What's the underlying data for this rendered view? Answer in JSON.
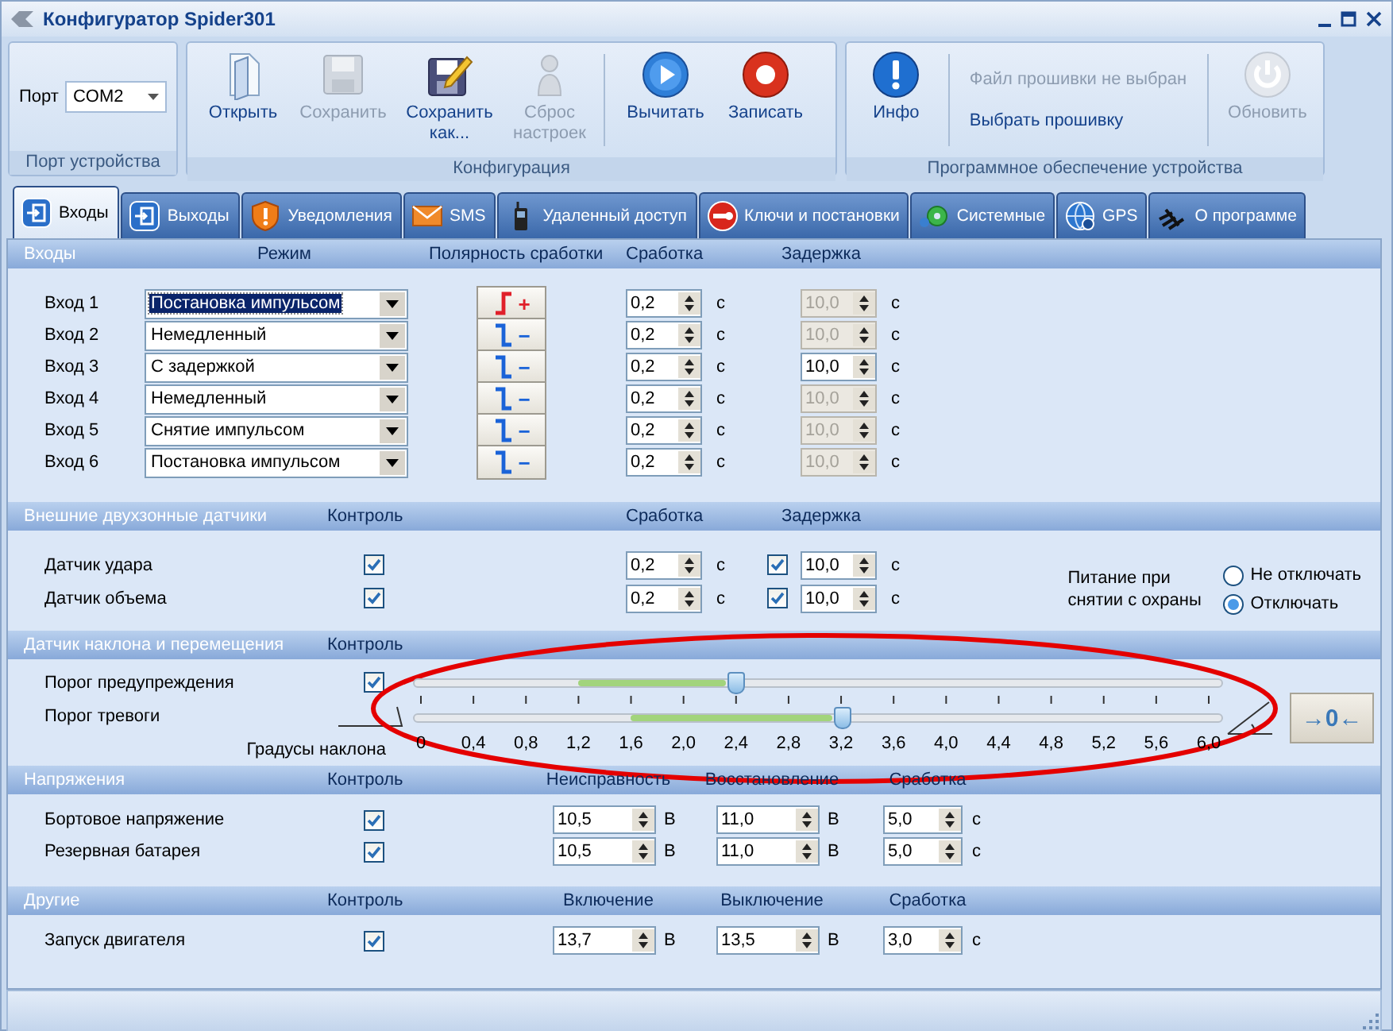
{
  "window": {
    "title": "Конфигуратор Spider301"
  },
  "ribbon": {
    "port_group": {
      "label": "Порт",
      "value": "COM2",
      "caption": "Порт устройства"
    },
    "config_group": {
      "caption": "Конфигурация",
      "file_buttons": [
        {
          "kind": "open",
          "label": "Открыть",
          "disabled": false
        },
        {
          "kind": "save",
          "label": "Сохранить",
          "disabled": true
        },
        {
          "kind": "save_as",
          "label": "Сохранить как...",
          "disabled": false
        },
        {
          "kind": "reset",
          "label": "Сброс настроек",
          "disabled": true
        }
      ],
      "device_buttons": [
        {
          "kind": "read",
          "label": "Вычитать",
          "disabled": false
        },
        {
          "kind": "write",
          "label": "Записать",
          "disabled": false
        }
      ]
    },
    "software_group": {
      "caption": "Программное обеспечение устройства",
      "info_button": {
        "label": "Инфо",
        "disabled": false
      },
      "firmware_status": "Файл прошивки не выбран",
      "select_firmware": "Выбрать прошивку",
      "update_button": {
        "label": "Обновить",
        "disabled": true
      }
    }
  },
  "tabs": [
    {
      "kind": "inputs",
      "label": "Входы",
      "selected": true
    },
    {
      "kind": "outputs",
      "label": "Выходы",
      "selected": false
    },
    {
      "kind": "notifications",
      "label": "Уведомления",
      "selected": false
    },
    {
      "kind": "sms",
      "label": "SMS",
      "selected": false
    },
    {
      "kind": "remote",
      "label": "Удаленный доступ",
      "selected": false
    },
    {
      "kind": "keys",
      "label": "Ключи и постановки",
      "selected": false
    },
    {
      "kind": "system",
      "label": "Системные",
      "selected": false
    },
    {
      "kind": "gps",
      "label": "GPS",
      "selected": false
    },
    {
      "kind": "about",
      "label": "О программе",
      "selected": false
    }
  ],
  "inputs": {
    "title": "Входы",
    "columns": [
      "Режим",
      "Полярность сработки",
      "Сработка",
      "Задержка"
    ],
    "rows": [
      {
        "label": "Вход 1",
        "mode": "Постановка импульсом",
        "focused": true,
        "kind": "rising",
        "sign": "+",
        "trip": "0,2",
        "trip_unit": "с",
        "delay": "10,0",
        "delay_enabled": false,
        "delay_unit": "с"
      },
      {
        "label": "Вход 2",
        "mode": "Немедленный",
        "focused": false,
        "kind": "falling",
        "sign": "−",
        "trip": "0,2",
        "trip_unit": "с",
        "delay": "10,0",
        "delay_enabled": false,
        "delay_unit": "с"
      },
      {
        "label": "Вход 3",
        "mode": "С задержкой",
        "focused": false,
        "kind": "falling",
        "sign": "−",
        "trip": "0,2",
        "trip_unit": "с",
        "delay": "10,0",
        "delay_enabled": true,
        "delay_unit": "с"
      },
      {
        "label": "Вход 4",
        "mode": "Немедленный",
        "focused": false,
        "kind": "falling",
        "sign": "−",
        "trip": "0,2",
        "trip_unit": "с",
        "delay": "10,0",
        "delay_enabled": false,
        "delay_unit": "с"
      },
      {
        "label": "Вход 5",
        "mode": "Снятие импульсом",
        "focused": false,
        "kind": "falling",
        "sign": "−",
        "trip": "0,2",
        "trip_unit": "с",
        "delay": "10,0",
        "delay_enabled": false,
        "delay_unit": "с"
      },
      {
        "label": "Вход 6",
        "mode": "Постановка импульсом",
        "focused": false,
        "kind": "falling",
        "sign": "−",
        "trip": "0,2",
        "trip_unit": "с",
        "delay": "10,0",
        "delay_enabled": false,
        "delay_unit": "с"
      }
    ]
  },
  "sensors": {
    "title": "Внешние двухзонные датчики",
    "columns": [
      "Контроль",
      "Сработка",
      "Задержка"
    ],
    "rows": [
      {
        "label": "Датчик удара",
        "control": true,
        "trip": "0,2",
        "trip_unit": "с",
        "delay_checked": true,
        "delay": "10,0",
        "delay_unit": "с"
      },
      {
        "label": "Датчик объема",
        "control": true,
        "trip": "0,2",
        "trip_unit": "с",
        "delay_checked": true,
        "delay": "10,0",
        "delay_unit": "с"
      }
    ],
    "power": {
      "label": "Питание при снятии с охраны",
      "options": [
        {
          "label": "Не отключать",
          "selected": false
        },
        {
          "label": "Отключать",
          "selected": true
        }
      ]
    }
  },
  "tilt": {
    "title": "Датчик наклона и перемещения",
    "columns": [
      "Контроль"
    ],
    "rows": [
      {
        "kind": "checkbox",
        "label": "Порог предупреждения",
        "control": true,
        "level": 0.4
      },
      {
        "kind": "icon",
        "label": "Порог тревоги",
        "level": 0.5333
      }
    ],
    "scale_label": "Градусы наклона",
    "scale": [
      "0",
      "0,4",
      "0,8",
      "1,2",
      "1,6",
      "2,0",
      "2,4",
      "2,8",
      "3,2",
      "3,6",
      "4,0",
      "4,4",
      "4,8",
      "5,2",
      "5,6",
      "6,0"
    ],
    "zero_button": "→0←"
  },
  "voltages": {
    "title": "Напряжения",
    "columns": [
      "Контроль",
      "Неисправность",
      "Восстановление",
      "Сработка"
    ],
    "rows": [
      {
        "label": "Бортовое напряжение",
        "control": true,
        "values": [
          {
            "value": "10,5",
            "unit": "В"
          },
          {
            "value": "11,0",
            "unit": "В"
          },
          {
            "value": "5,0",
            "unit": "с"
          }
        ]
      },
      {
        "label": "Резервная батарея",
        "control": true,
        "values": [
          {
            "value": "10,5",
            "unit": "В"
          },
          {
            "value": "11,0",
            "unit": "В"
          },
          {
            "value": "5,0",
            "unit": "с"
          }
        ]
      }
    ]
  },
  "others": {
    "title": "Другие",
    "columns": [
      "Контроль",
      "Включение",
      "Выключение",
      "Сработка"
    ],
    "rows": [
      {
        "label": "Запуск двигателя",
        "control": true,
        "values": [
          {
            "value": "13,7",
            "unit": "В"
          },
          {
            "value": "13,5",
            "unit": "В"
          },
          {
            "value": "3,0",
            "unit": "с"
          }
        ]
      }
    ]
  },
  "annotation": {
    "kind": "ellipse"
  }
}
